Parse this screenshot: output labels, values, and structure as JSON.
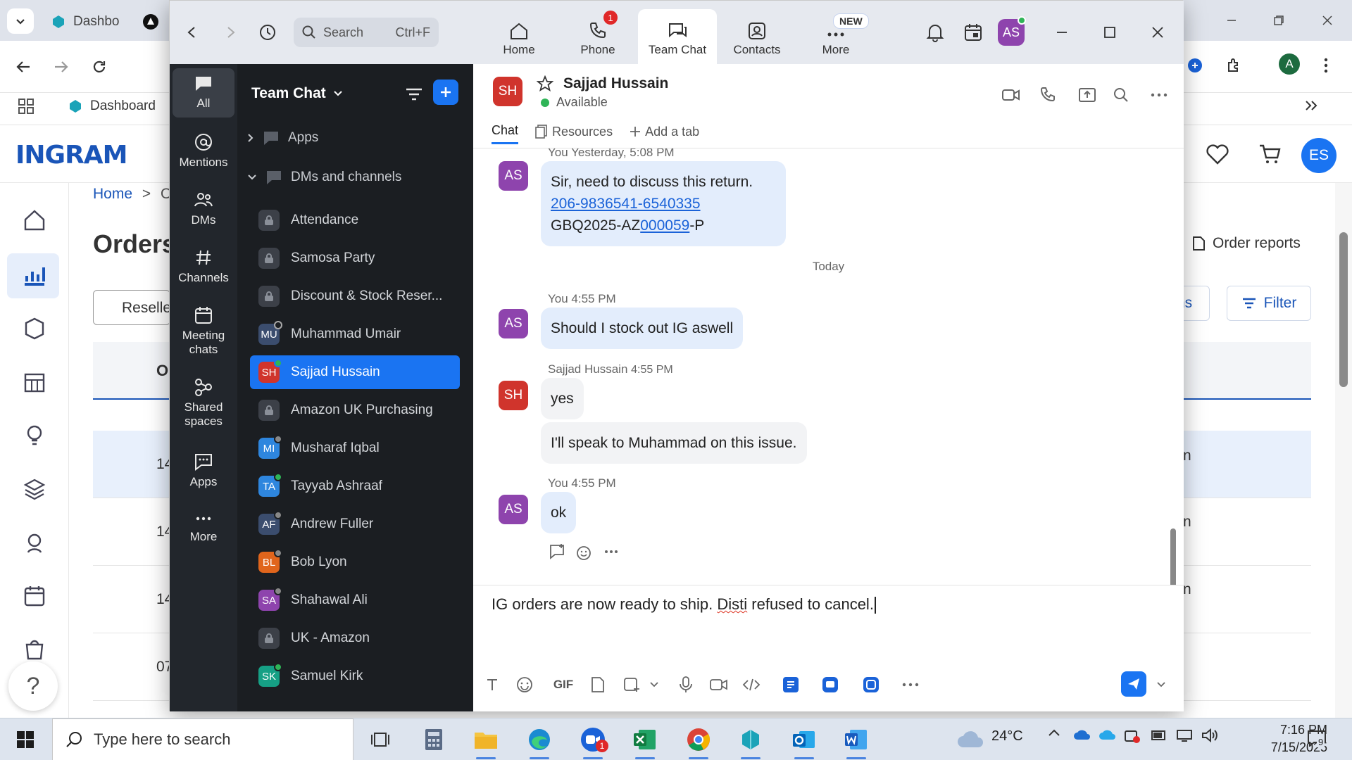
{
  "browser": {
    "tab_label": "Dashbo",
    "bookmark_label": "Dashboard",
    "brand_logo": "INGRAM",
    "account_initial": "A",
    "user_initials": "ES",
    "breadcrumb_home": "Home",
    "breadcrumb_sep": ">",
    "breadcrumb_next": "O",
    "page_title": "Orders",
    "order_reports_label": "Order reports",
    "filter_label": "Filter",
    "partial_button_label": "ns",
    "reseller_label": "Reselle",
    "header_first_col": "O",
    "row_codes": [
      "14",
      "14",
      "14",
      "07"
    ],
    "row_suffix": "n",
    "help_label": "?"
  },
  "zoom": {
    "search": {
      "placeholder": "Search",
      "shortcut": "Ctrl+F"
    },
    "nav_tabs": [
      {
        "label": "Home"
      },
      {
        "label": "Phone",
        "badge": "1"
      },
      {
        "label": "Team Chat"
      },
      {
        "label": "Contacts"
      },
      {
        "label": "More",
        "badge": "NEW"
      }
    ],
    "user_avatar_initials": "AS",
    "rail": [
      {
        "label": "All"
      },
      {
        "label": "Mentions"
      },
      {
        "label": "DMs"
      },
      {
        "label": "Channels"
      },
      {
        "label": "Meeting chats"
      },
      {
        "label": "Shared spaces"
      },
      {
        "label": "Apps"
      },
      {
        "label": "More"
      }
    ],
    "channel_list": {
      "title": "Team Chat",
      "apps_section": "Apps",
      "dms_section": "DMs and channels",
      "items": [
        {
          "label": "Attendance",
          "type": "channel"
        },
        {
          "label": "Samosa Party",
          "type": "channel"
        },
        {
          "label": "Discount & Stock Reser...",
          "type": "channel"
        },
        {
          "label": "Muhammad Umair",
          "initials": "MU",
          "color": "#3b4d6e",
          "status": "#888888"
        },
        {
          "label": "Sajjad Hussain",
          "initials": "SH",
          "color": "#d0342c",
          "status": "#2fb457"
        },
        {
          "label": "Amazon UK Purchasing",
          "type": "channel"
        },
        {
          "label": "Musharaf Iqbal",
          "initials": "MI",
          "color": "#2e86de",
          "status": "#888888"
        },
        {
          "label": "Tayyab Ashraaf",
          "initials": "TA",
          "color": "#2e86de",
          "status": "#2fb457"
        },
        {
          "label": "Andrew Fuller",
          "initials": "AF",
          "color": "#3b4d6e",
          "status": "#888888"
        },
        {
          "label": "Bob Lyon",
          "initials": "BL",
          "color": "#e0651c",
          "status": "#888888"
        },
        {
          "label": "Shahawal Ali",
          "initials": "SA",
          "color": "#8e44ad",
          "status": "#888888"
        },
        {
          "label": "UK - Amazon",
          "type": "channel"
        },
        {
          "label": "Samuel Kirk",
          "initials": "SK",
          "color": "#16a085",
          "status": "#2fb457"
        }
      ]
    },
    "chat": {
      "contact_initials": "SH",
      "contact_name": "Sajjad Hussain",
      "contact_status": "Available",
      "tabs": [
        "Chat",
        "Resources",
        "Add a tab"
      ],
      "first_meta": "You Yesterday, 5:08 PM",
      "first_msg_line1": "Sir, need to discuss this return.",
      "first_msg_link": "206-9836541-6540335",
      "first_msg_line3_prefix": "GBQ2025-AZ",
      "first_msg_line3_link": "000059",
      "first_msg_line3_suffix": "-P",
      "day_separator": "Today",
      "msg2_meta": "You 4:55 PM",
      "msg2_text": "Should I stock out IG aswell",
      "msg3_sender": "Sajjad Hussain",
      "msg3_time": "4:55 PM",
      "msg3_text": "yes",
      "msg4_text": "I'll speak to Muhammad on this issue.",
      "msg5_meta": "You 4:55 PM",
      "msg5_text": "ok",
      "my_initials": "AS",
      "composer_prefix": "IG orders are now ready to ship. ",
      "composer_misspelled": "Disti",
      "composer_suffix": " refused to cancel.",
      "gif_label": "GIF"
    }
  },
  "taskbar": {
    "search_placeholder": "Type here to search",
    "zoom_badge": "1",
    "temperature": "24°C",
    "time": "7:16 PM",
    "date": "7/15/2025",
    "notification_count": "9"
  },
  "colors": {
    "zoom_blue": "#1a74f2",
    "ingram_blue": "#1a55b8",
    "rail_bg": "#22262c",
    "list_bg": "#1b1e22",
    "my_bubble": "#e3edfc",
    "other_bubble": "#f2f3f5"
  }
}
